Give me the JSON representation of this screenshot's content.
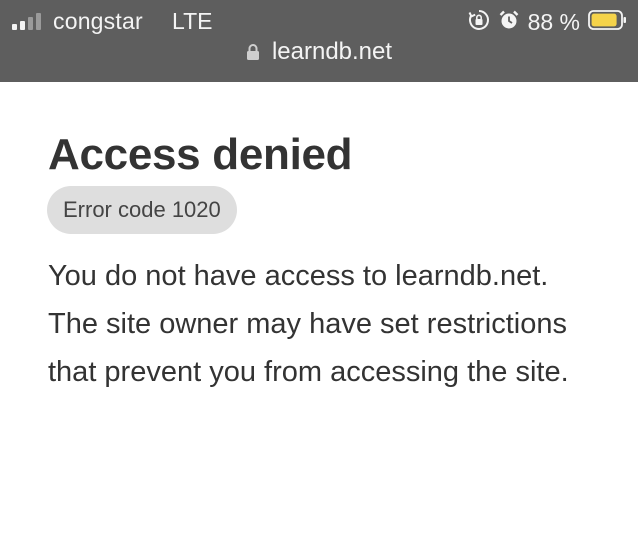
{
  "status_bar": {
    "carrier": "congstar",
    "network": "LTE",
    "battery_percent": "88 %",
    "icons": [
      "signal-icon",
      "rotation-lock-icon",
      "alarm-icon",
      "battery-icon"
    ],
    "battery_color": "#f5d34a"
  },
  "address_bar": {
    "url": "learndb.net",
    "icon": "lock-icon"
  },
  "page": {
    "title": "Access denied",
    "error_code": "Error code 1020",
    "message_line1": "You do not have access to learndb.net.",
    "message_line2": "The site owner may have set restrictions that prevent you from accessing the site."
  }
}
